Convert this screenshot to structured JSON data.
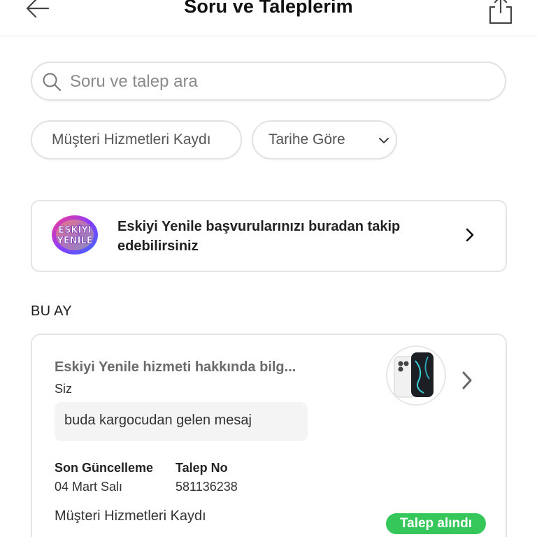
{
  "header": {
    "title": "Soru ve Taleplerim",
    "back_icon": "arrow-left-icon",
    "share_icon": "share-icon"
  },
  "search": {
    "placeholder": "Soru ve talep ara",
    "value": ""
  },
  "filters": [
    {
      "label": "Müşteri Hizmetleri Kaydı"
    },
    {
      "label": "Tarihe Göre",
      "icon": "chevron-down-icon"
    }
  ],
  "promo": {
    "logo_text": "ESKİYİ YENİLE",
    "text": "Eskiyi Yenile başvurularınızı buradan takip edebilirsiniz"
  },
  "section": {
    "title": "BU AY"
  },
  "request": {
    "title": "Eskiyi Yenile hizmeti hakkında bilg...",
    "from": "Siz",
    "message": "buda kargocudan gelen mesaj",
    "last_update_label": "Son Güncelleme",
    "last_update_value": "04 Mart Salı",
    "request_no_label": "Talep No",
    "request_no_value": "581136238",
    "category": "Müşteri Hizmetleri Kaydı",
    "status": "Talep alındı"
  },
  "colors": {
    "status_green": "#35c759",
    "border": "#e5e5e5",
    "bubble": "#f4f4f4"
  }
}
